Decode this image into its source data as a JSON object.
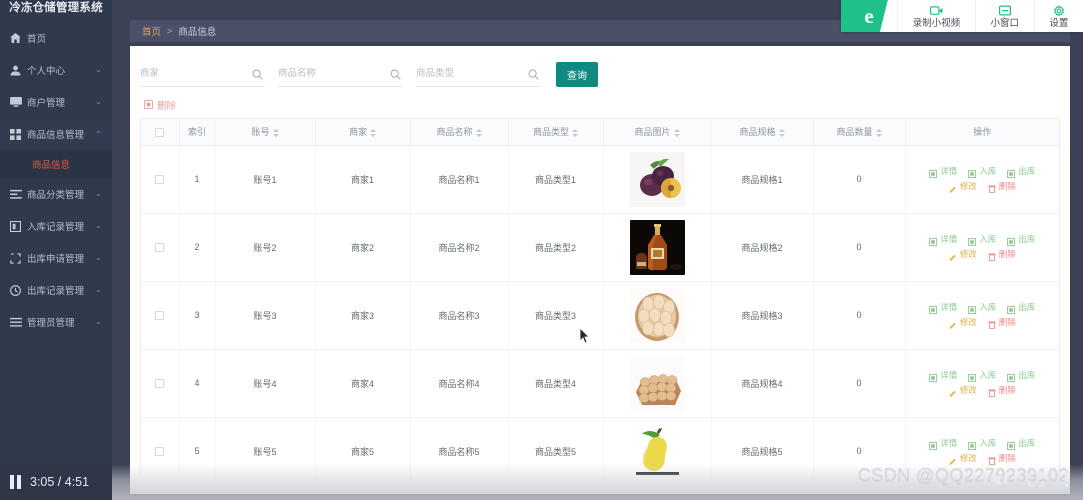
{
  "sidebar": {
    "title": "冷冻仓储管理系统",
    "items": [
      {
        "label": "首页",
        "icon": "home-icon",
        "arrow": "",
        "expanded": false
      },
      {
        "label": "个人中心",
        "icon": "user-icon",
        "arrow": "⌄",
        "expanded": false
      },
      {
        "label": "商户管理",
        "icon": "shop-icon",
        "arrow": "⌄",
        "expanded": false
      },
      {
        "label": "商品信息管理",
        "icon": "grid-icon",
        "arrow": "⌃",
        "expanded": true
      },
      {
        "label": "商品分类管理",
        "icon": "category-icon",
        "arrow": "⌄",
        "expanded": false
      },
      {
        "label": "入库记录管理",
        "icon": "inbound-icon",
        "arrow": "⌄",
        "expanded": false
      },
      {
        "label": "出库申请管理",
        "icon": "outbound-apply-icon",
        "arrow": "⌄",
        "expanded": false
      },
      {
        "label": "出库记录管理",
        "icon": "clock-icon",
        "arrow": "⌄",
        "expanded": false
      },
      {
        "label": "管理员管理",
        "icon": "list-icon",
        "arrow": "⌄",
        "expanded": false
      }
    ],
    "submenu": {
      "label": "商品信息",
      "active": true
    }
  },
  "breadcrumb": {
    "home": "首页",
    "separator": ">",
    "current": "商品信息"
  },
  "search": {
    "fields": [
      {
        "placeholder": "商家",
        "value": ""
      },
      {
        "placeholder": "商品名称",
        "value": ""
      },
      {
        "placeholder": "商品类型",
        "value": ""
      }
    ],
    "query_label": "查询"
  },
  "toolbar": {
    "delete_label": "删除"
  },
  "table": {
    "columns": [
      {
        "label": "",
        "sortable": false,
        "key": "check"
      },
      {
        "label": "索引",
        "sortable": false,
        "key": "index"
      },
      {
        "label": "账号",
        "sortable": true,
        "key": "account"
      },
      {
        "label": "商家",
        "sortable": true,
        "key": "merchant"
      },
      {
        "label": "商品名称",
        "sortable": true,
        "key": "name"
      },
      {
        "label": "商品类型",
        "sortable": true,
        "key": "type"
      },
      {
        "label": "商品图片",
        "sortable": true,
        "key": "image"
      },
      {
        "label": "商品规格",
        "sortable": true,
        "key": "spec"
      },
      {
        "label": "商品数量",
        "sortable": true,
        "key": "qty"
      },
      {
        "label": "操作",
        "sortable": false,
        "key": "ops"
      }
    ],
    "rows": [
      {
        "index": "1",
        "account": "账号1",
        "merchant": "商家1",
        "name": "商品名称1",
        "type": "商品类型1",
        "image": "plums-photo",
        "spec": "商品规格1",
        "qty": "0"
      },
      {
        "index": "2",
        "account": "账号2",
        "merchant": "商家2",
        "name": "商品名称2",
        "type": "商品类型2",
        "image": "brandy-bottle-photo",
        "spec": "商品规格2",
        "qty": "0"
      },
      {
        "index": "3",
        "account": "账号3",
        "merchant": "商家3",
        "name": "商品名称3",
        "type": "商品类型3",
        "image": "eggs-basket-photo",
        "spec": "商品规格3",
        "qty": "0"
      },
      {
        "index": "4",
        "account": "账号4",
        "merchant": "商家4",
        "name": "商品名称4",
        "type": "商品类型4",
        "image": "egg-carton-photo",
        "spec": "商品规格4",
        "qty": "0"
      },
      {
        "index": "5",
        "account": "账号5",
        "merchant": "商家5",
        "name": "商品名称5",
        "type": "商品类型5",
        "image": "pear-photo",
        "spec": "商品规格5",
        "qty": "0"
      }
    ],
    "ops": {
      "detail": "详情",
      "stock_in": "入库",
      "stock_out": "出库",
      "edit": "修改",
      "delete": "删除"
    }
  },
  "recorder": {
    "logo": "e",
    "items": [
      {
        "label": "录制小视频",
        "icon": "video-record-icon"
      },
      {
        "label": "小窗口",
        "icon": "minimize-window-icon"
      },
      {
        "label": "设置",
        "icon": "gear-icon"
      }
    ]
  },
  "player": {
    "play_state": "paused",
    "current_time": "3:05",
    "separator": "/",
    "total_time": "4:51",
    "time_display": "3:05 / 4:51"
  },
  "watermark": "CSDN @QQ2279239102",
  "colors": {
    "sidebar_bg": "#303a4d",
    "page_bg": "#3b4256",
    "accent_teal": "#0e8a80",
    "active_menu": "#e8543f",
    "breadcrumb_home": "#e0a458",
    "op_green": "#8cc98f",
    "op_orange": "#e6b04a",
    "op_red": "#ef8a8a",
    "recorder_green": "#1fc08a"
  }
}
